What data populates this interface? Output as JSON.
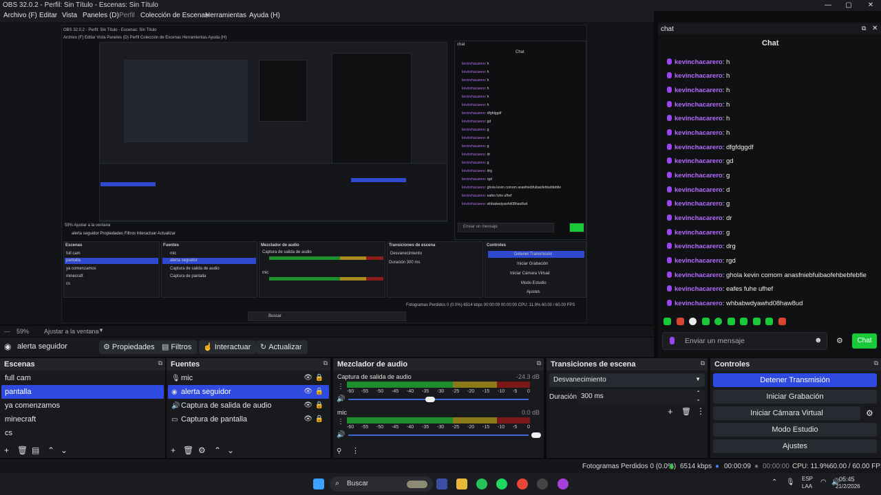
{
  "window": {
    "title": "OBS 32.0.2 - Perfil: Sin Título - Escenas: Sin Título",
    "minimize_icon": "minimize-icon",
    "maximize_icon": "maximize-icon",
    "close_icon": "close-icon"
  },
  "menu": [
    "Archivo (F)",
    "Editar",
    "Vista",
    "Paneles (D)",
    "Perfil",
    "Colección de Escenas",
    "Herramientas",
    "Ayuda (H)"
  ],
  "zoom": {
    "value": "59%",
    "label": "Ajustar a la ventana"
  },
  "toolbar": {
    "current_source": "alerta seguidor",
    "properties": "Propiedades",
    "filters": "Filtros",
    "interact": "Interactuar",
    "refresh": "Actualizar"
  },
  "scenes": {
    "title": "Escenas",
    "items": [
      "full cam",
      "pantalla",
      "ya comenzamos",
      "minecraft",
      "cs"
    ],
    "selected_index": 1
  },
  "sources": {
    "title": "Fuentes",
    "items": [
      {
        "label": "mic",
        "icon": "mic-icon"
      },
      {
        "label": "alerta seguidor",
        "icon": "globe-icon"
      },
      {
        "label": "Captura de salida de audio",
        "icon": "speaker-icon"
      },
      {
        "label": "Captura de pantalla",
        "icon": "monitor-icon"
      }
    ],
    "selected_index": 1
  },
  "mixer": {
    "title": "Mezclador de audio",
    "tracks": [
      {
        "name": "Captura de salida de audio",
        "db": "-24.3 dB",
        "level": 0.55,
        "volume": 0.45
      },
      {
        "name": "mic",
        "db": "0.0 dB",
        "level": 0.55,
        "volume": 1.0
      }
    ],
    "scale": [
      "-60",
      "-55",
      "-50",
      "-45",
      "-40",
      "-35",
      "-30",
      "-25",
      "-20",
      "-15",
      "-10",
      "-5",
      "0"
    ]
  },
  "transitions": {
    "title": "Transiciones de escena",
    "selected": "Desvanecimiento",
    "duration_label": "Duración",
    "duration_value": "300 ms"
  },
  "controls": {
    "title": "Controles",
    "buttons": [
      "Detener Transmisión",
      "Iniciar Grabación",
      "Iniciar Cámara Virtual",
      "Modo Estudio",
      "Ajustes"
    ]
  },
  "status": {
    "dropped": "Fotogramas Perdidos 0 (0.0%)",
    "bitrate": "6514 kbps",
    "stream_time": "00:00:09",
    "rec_time": "00:00:00",
    "cpu": "CPU: 11.9%",
    "fps": "60.00 / 60.00 FPS"
  },
  "taskbar": {
    "search": "Buscar",
    "lang1": "ESP",
    "lang2": "LAA",
    "time": "05:45",
    "date": "21/2/2026"
  },
  "chat": {
    "dock_title": "chat",
    "title": "Chat",
    "messages": [
      {
        "user": "kevinchacarero",
        "text": "h"
      },
      {
        "user": "kevinchacarero",
        "text": "h"
      },
      {
        "user": "kevinchacarero",
        "text": "h"
      },
      {
        "user": "kevinchacarero",
        "text": "h"
      },
      {
        "user": "kevinchacarero",
        "text": "h"
      },
      {
        "user": "kevinchacarero",
        "text": "h"
      },
      {
        "user": "kevinchacarero",
        "text": "dfgfdggdf"
      },
      {
        "user": "kevinchacarero",
        "text": "gd"
      },
      {
        "user": "kevinchacarero",
        "text": "g"
      },
      {
        "user": "kevinchacarero",
        "text": "d"
      },
      {
        "user": "kevinchacarero",
        "text": "g"
      },
      {
        "user": "kevinchacarero",
        "text": "dr"
      },
      {
        "user": "kevinchacarero",
        "text": "g"
      },
      {
        "user": "kevinchacarero",
        "text": "drg"
      },
      {
        "user": "kevinchacarero",
        "text": "rgd"
      },
      {
        "user": "kevinchacarero",
        "text": "ghola kevin comom anasfniebfuibaofehbebfebfie"
      },
      {
        "user": "kevinchacarero",
        "text": "eafes fuhe ufhef"
      },
      {
        "user": "kevinchacarero",
        "text": "whbabwdyawhd08haw8ud"
      }
    ],
    "placeholder": "Enviar un mensaje",
    "send": "Chat"
  },
  "colors": {
    "accent": "#2f4ae0",
    "chat_user": "#b46cff",
    "chat_send": "#19c93a"
  }
}
